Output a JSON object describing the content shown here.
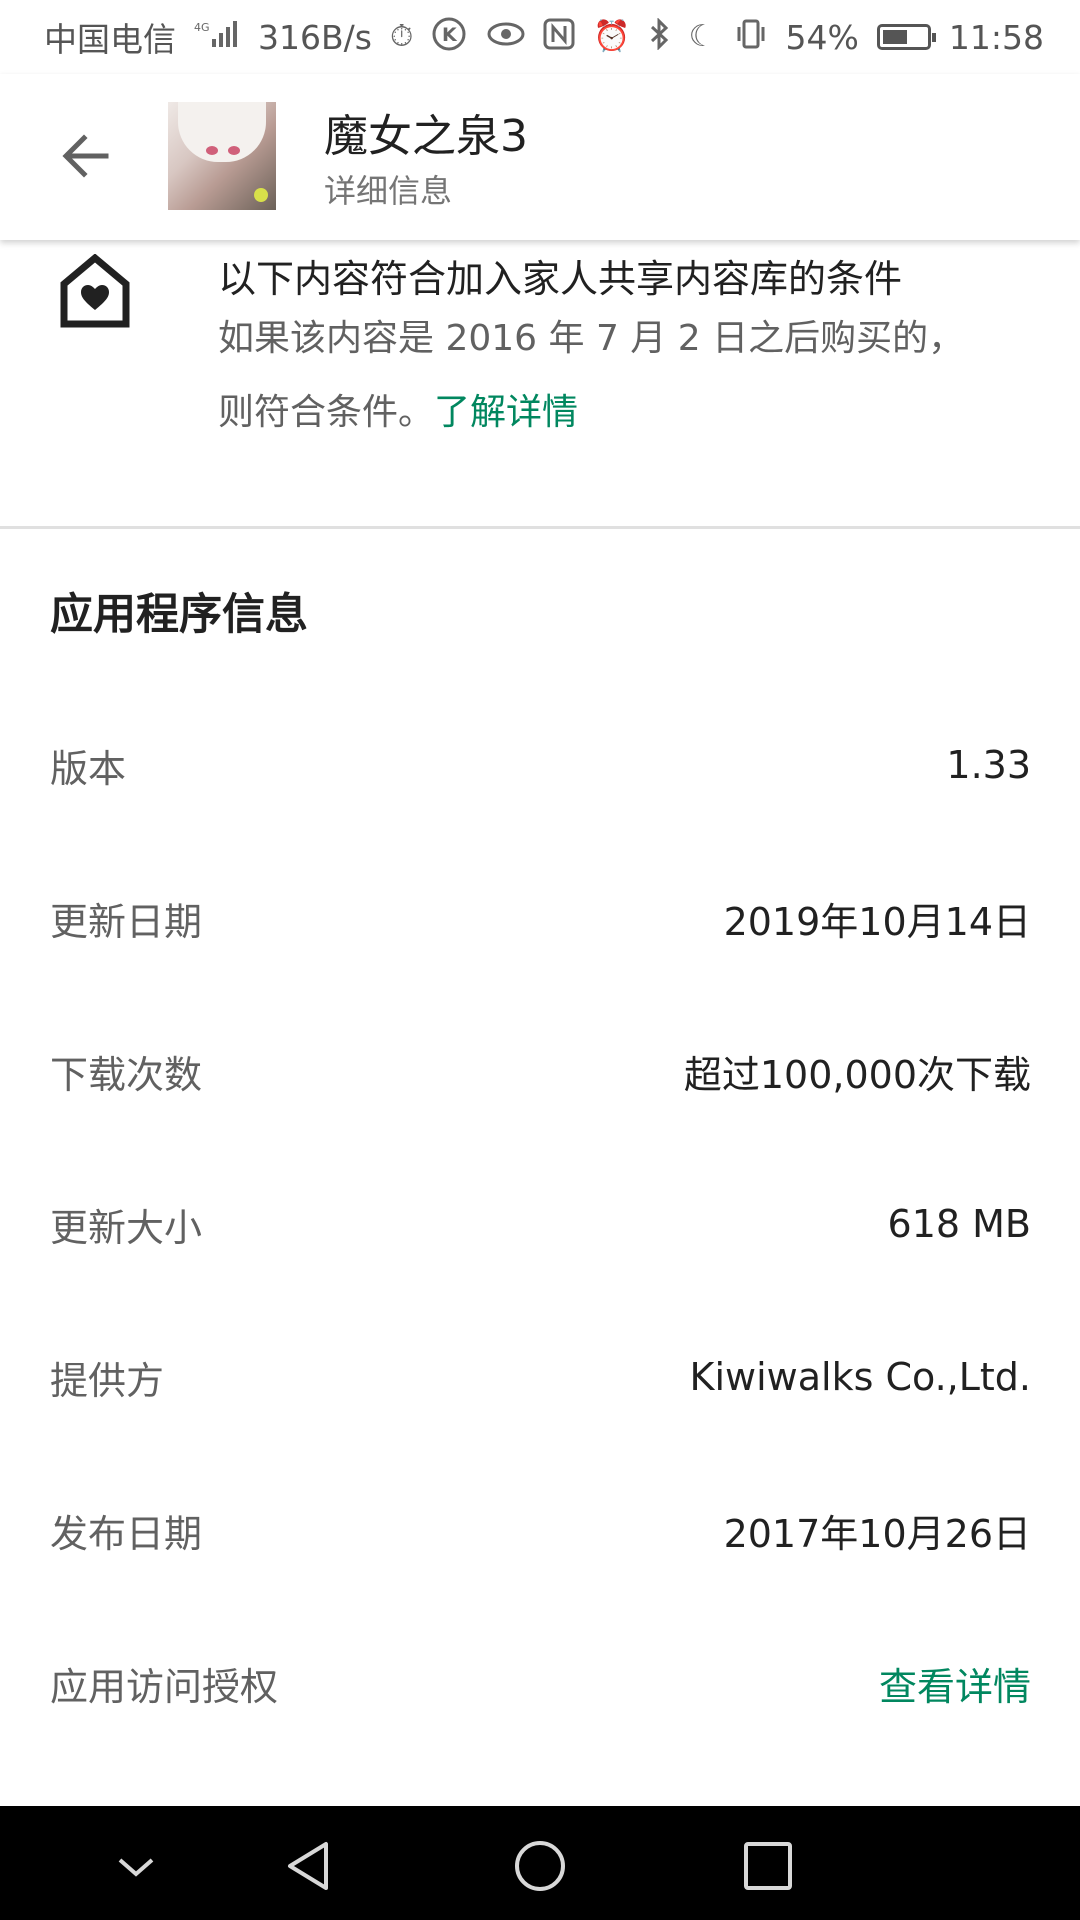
{
  "status_bar": {
    "carrier": "中国电信",
    "network": "4G",
    "speed": "316B/s",
    "battery": "54%",
    "time": "11:58",
    "icons": [
      "signal-icon",
      "timer-icon",
      "k-app-icon",
      "eye-icon",
      "nfc-icon",
      "alarm-icon",
      "bluetooth-icon",
      "moon-icon",
      "vibrate-icon",
      "battery-icon"
    ]
  },
  "app_bar": {
    "title": "魔女之泉3",
    "subtitle": "详细信息"
  },
  "family": {
    "title": "以下内容符合加入家人共享内容库的条件",
    "description": "如果该内容是 2016 年 7 月 2 日之后购买的，则符合条件。",
    "learn_more": "了解详情"
  },
  "app_info": {
    "title": "应用程序信息",
    "rows": [
      {
        "label": "版本",
        "value": "1.33"
      },
      {
        "label": "更新日期",
        "value": "2019年10月14日"
      },
      {
        "label": "下载次数",
        "value": "超过100,000次下载"
      },
      {
        "label": "更新大小",
        "value": "618 MB"
      },
      {
        "label": "提供方",
        "value": "Kiwiwalks Co.,Ltd."
      },
      {
        "label": "发布日期",
        "value": "2017年10月26日"
      },
      {
        "label": "应用访问授权",
        "value": "查看详情"
      }
    ]
  },
  "colors": {
    "accent": "#01875f",
    "text_primary": "#212121",
    "text_secondary": "#616161",
    "nav_background": "#000000"
  }
}
